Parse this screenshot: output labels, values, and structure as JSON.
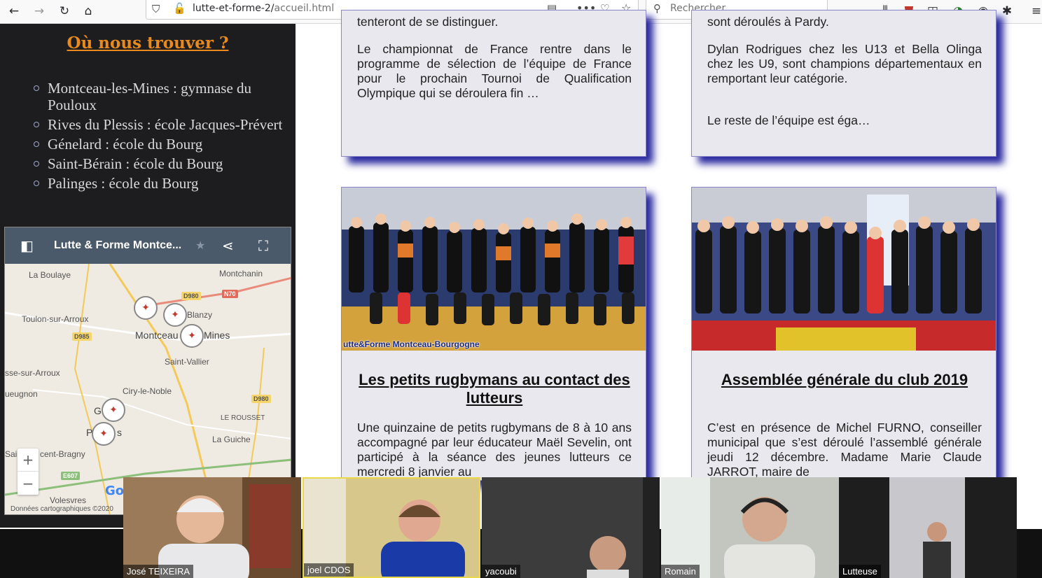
{
  "browser": {
    "url_main": "lutte-et-forme-2/",
    "url_path": "accueil.html",
    "search_placeholder": "Rechercher"
  },
  "sidebar": {
    "title": "Où nous trouver ?",
    "locations": [
      "Montceau-les-Mines : gymnase du Pouloux",
      "Rives du Plessis : école Jacques-Prévert",
      "Génelard : école du Bourg",
      "Saint-Bérain : école du Bourg",
      "Palinges : école du Bourg"
    ]
  },
  "map": {
    "title": "Lutte & Forme Montce...",
    "labels": {
      "la_boulaye": "La Boulaye",
      "montchanin": "Montchanin",
      "toulon": "Toulon-sur-Arroux",
      "blanzy": "Blanzy",
      "montceau": "Montceau",
      "mines": "Mines",
      "saint_vallier": "Saint-Vallier",
      "issy": "sse-sur-Arroux",
      "ciry": "Ciry-le-Noble",
      "gueugnon": "ueugnon",
      "le_rousset": "LE ROUSSET",
      "la_guiche": "La Guiche",
      "g": "G",
      "p": "P",
      "s": "s",
      "bragny": "cent-Bragny",
      "sai": "Sai",
      "volesvres": "Volesvres"
    },
    "roads": {
      "d980a": "D980",
      "n70": "N70",
      "d985": "D985",
      "d980b": "D980",
      "e607": "E607"
    },
    "zoom_in": "+",
    "zoom_out": "−",
    "credit": "Données cartographiques ©2020",
    "google": "Go"
  },
  "cards": {
    "c1_top": "tenteront de se distinguer.",
    "c1_body": "Le championnat de France rentre dans le programme de sélection de l’équipe de France pour le prochain Tournoi de Qualification Olympique qui se déroulera fin …",
    "c2_top": "sont déroulés à Pardy.",
    "c2_body": "Dylan Rodrigues chez les U13 et Bella Olinga chez les U9, sont champions départementaux en remportant leur catégorie.",
    "c2_more": "Le reste de l’équipe est éga…",
    "c3_caption": "utte&Forme Montceau-Bourgogne",
    "c3_title": "Les petits rugbymans au contact des lutteurs",
    "c3_body": "Une quinzaine de petits rugbymans de 8 à 10 ans accompagné par leur éducateur Maël Sevelin, ont participé à la séance des jeunes lutteurs ce mercredi 8 janvier au",
    "c4_title": "Assemblée générale du club 2019",
    "c4_body": "C’est en présence de Michel FURNO, conseiller municipal que s’est déroulé l’assemblé générale jeudi 12 décembre. Madame Marie Claude JARROT, maire de"
  },
  "participants": [
    "José TEIXEIRA",
    "joel CDOS",
    "yacoubi",
    "Romain",
    "Lutteuse"
  ]
}
